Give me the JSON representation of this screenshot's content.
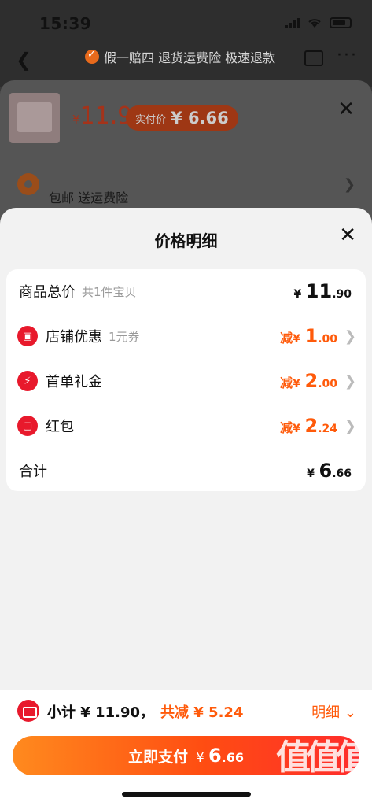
{
  "status_bar": {
    "time": "15:39"
  },
  "background": {
    "guarantee_text": "假一赔四 退货运费险 极速退款",
    "price_currency": "¥",
    "price": "11.9",
    "actual_label": "实付价",
    "actual_value": "¥ 6.66",
    "shipping_text": "包邮  送运费险"
  },
  "sheet": {
    "title": "价格明细",
    "rows": [
      {
        "label": "商品总价",
        "sub": "共1件宝贝",
        "currency": "¥",
        "int": "11",
        "dec": ".90"
      },
      {
        "label": "店铺优惠",
        "sub": "1元券",
        "prefix": "减",
        "currency": "¥",
        "int": "1",
        "dec": ".00",
        "icon": "shop-icon"
      },
      {
        "label": "首单礼金",
        "prefix": "减",
        "currency": "¥",
        "int": "2",
        "dec": ".00",
        "icon": "lightning-icon"
      },
      {
        "label": "红包",
        "prefix": "减",
        "currency": "¥",
        "int": "2",
        "dec": ".24",
        "icon": "red-envelope-icon"
      },
      {
        "label": "合计",
        "currency": "¥",
        "int": "6",
        "dec": ".66"
      }
    ]
  },
  "bottom": {
    "subtotal": "小计 ¥ 11.90，",
    "reduce": "共减 ¥ 5.24",
    "detail": "明细",
    "pay_label": "立即支付",
    "pay_currency": "¥",
    "pay_int": "6",
    "pay_dec": ".66"
  },
  "watermark": {
    "mark": "值值值",
    "url": "zhizhizhi.com"
  },
  "colors": {
    "accent": "#ff5a0a",
    "red": "#e8192c",
    "sheet_bg": "#f2f2f2"
  }
}
